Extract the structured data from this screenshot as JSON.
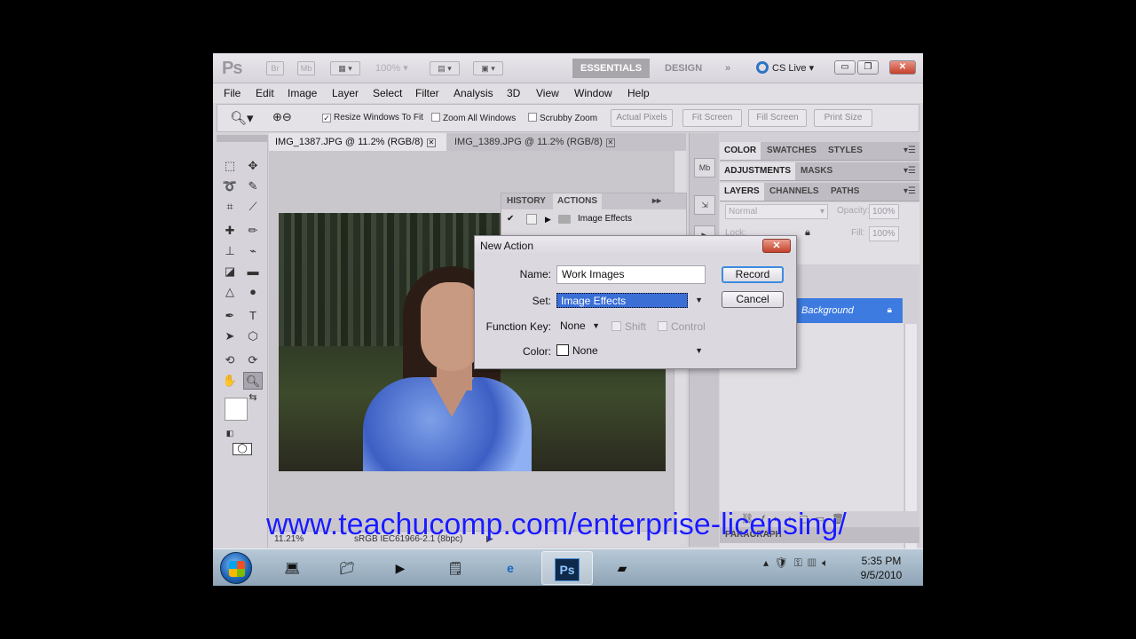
{
  "app": {
    "logo": "Ps",
    "zoom_display": "100%",
    "workspace_active": "ESSENTIALS",
    "workspace_design": "DESIGN",
    "workspace_more": "»",
    "cs_live": "CS Live",
    "window_controls": {
      "minimize": "▭",
      "restore": "❐",
      "close": "✕"
    }
  },
  "menu": [
    "File",
    "Edit",
    "Image",
    "Layer",
    "Select",
    "Filter",
    "Analysis",
    "3D",
    "View",
    "Window",
    "Help"
  ],
  "options_bar": {
    "resize_windows": "Resize Windows To Fit",
    "zoom_all": "Zoom All Windows",
    "scrubby": "Scrubby Zoom",
    "actual_pixels": "Actual Pixels",
    "fit_screen": "Fit Screen",
    "fill_screen": "Fill Screen",
    "print_size": "Print Size"
  },
  "documents": {
    "active_tab": "IMG_1387.JPG @ 11.2% (RGB/8)",
    "inactive_tab": "IMG_1389.JPG @ 11.2% (RGB/8)"
  },
  "history_panel": {
    "tab_history": "HISTORY",
    "tab_actions": "ACTIONS",
    "row_label": "Image Effects"
  },
  "right_panels": {
    "group1": [
      "COLOR",
      "SWATCHES",
      "STYLES"
    ],
    "group2": [
      "ADJUSTMENTS",
      "MASKS"
    ],
    "group3": [
      "LAYERS",
      "CHANNELS",
      "PATHS"
    ],
    "blend_mode": "Normal",
    "opacity_label": "Opacity:",
    "opacity_value": "100%",
    "lock_label": "Lock:",
    "fill_label": "Fill:",
    "fill_value": "100%",
    "layer_name": "Background",
    "paragraph": "PARAGRAPH"
  },
  "status_bar": {
    "zoom": "11.21%",
    "profile": "sRGB IEC61966-2.1 (8bpc)"
  },
  "dialog": {
    "title": "New Action",
    "name_label": "Name:",
    "name_value": "Work Images",
    "set_label": "Set:",
    "set_value": "Image Effects",
    "function_key_label": "Function Key:",
    "function_key_value": "None",
    "shift_label": "Shift",
    "control_label": "Control",
    "color_label": "Color:",
    "color_value": "None",
    "record_button": "Record",
    "cancel_button": "Cancel",
    "close": "✕"
  },
  "taskbar": {
    "time": "5:35 PM",
    "date": "9/5/2010",
    "ps_label": "Ps"
  },
  "watermark": "www.teachucomp.com/enterprise-licensing/"
}
